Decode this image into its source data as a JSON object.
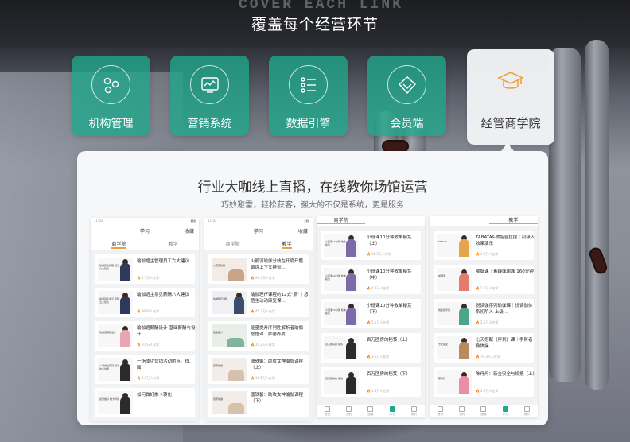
{
  "background_sign": "COVER EACH LINK",
  "heading": "覆盖每个经营环节",
  "tiles": [
    {
      "label": "机构管理",
      "icon": "nodes-icon"
    },
    {
      "label": "营销系统",
      "icon": "monitor-chart-icon"
    },
    {
      "label": "数据引擎",
      "icon": "list-icon"
    },
    {
      "label": "会员端",
      "icon": "diamond-icon"
    },
    {
      "label": "经管商学院",
      "icon": "graduation-cap-icon",
      "active": true
    }
  ],
  "colors": {
    "tile_green": "#1fa88c",
    "accent_orange": "#f0a13a",
    "card_bg": "#f6f7f9"
  },
  "card": {
    "title": "行业大咖线上直播，在线教你场馆运营",
    "subtitle": "巧妙避雷，轻松获客，强大的不仅是系统，更是服务"
  },
  "phones": [
    {
      "status_time": "11:02",
      "header_title": "学习",
      "header_right": "收藏",
      "tabs": [
        {
          "label": "商学院",
          "on": true
        },
        {
          "label": "教学",
          "on": false
        }
      ],
      "items": [
        {
          "thumb": "瑜伽馆主管理 员工六大建议",
          "title": "瑜伽馆主管理员工六大建议",
          "views": "1.1万人在学"
        },
        {
          "thumb": "瑜伽馆主常见 薪酬五大建议",
          "title": "瑜伽馆主常见薪酬八大建议",
          "views": "9695人在学"
        },
        {
          "thumb": "瑜伽馆薪酬设计",
          "title": "瑜伽馆薪酬设计-基础薪酬与设计",
          "views": "9.6万人在学"
        },
        {
          "thumb": "一场成功营销 活动的点线面",
          "title": "一场成功营销活动的点、线、面",
          "views": "1.1万人在学"
        },
        {
          "thumb": "如何做好 推卡转化",
          "title": "如何做好推卡转化",
          "views": ""
        }
      ]
    },
    {
      "status_time": "11:02",
      "header_title": "学习",
      "header_right": "收藏",
      "tabs": [
        {
          "label": "商学院",
          "on": false
        },
        {
          "label": "教学",
          "on": true
        }
      ],
      "items": [
        {
          "thumb": "火箭流瑜伽",
          "title": "火箭流瑜伽分歧在开肩开髋｜锻炼上下叉特训...",
          "views": "20.4万人在学"
        },
        {
          "thumb": "瑜伽理疗课程",
          "title": "瑜伽理疗课程的12式\"肌\"｜悠悟主动动康复保...",
          "views": "45.2万人在学"
        },
        {
          "thumb": "能量提升",
          "title": "能量提升序列胜解析者瑜伽｜悠悟课 · 萨德养成...",
          "views": "20.2万人在学"
        },
        {
          "thumb": "唐唐瑜伽",
          "title": "唐轶馨：助攻女神瑜伽课程（上）",
          "views": "11.5万人在学"
        },
        {
          "thumb": "唐唐瑜伽",
          "title": "唐轶馨：助攻女神瑜伽课程（下）",
          "views": ""
        }
      ]
    },
    {
      "header_title": "商学院",
      "items": [
        {
          "thumb": "小班课10分钟 收单秘笈",
          "title": "小班课10分钟收单秘笈（上）",
          "views": "16.2万人在学"
        },
        {
          "thumb": "小班课10分钟 收单秘笈",
          "title": "小班课10分钟收单秘笈（中）",
          "views": "4.4万人在学"
        },
        {
          "thumb": "小班课10分钟 收单秘笈",
          "title": "小班课10分钟收单秘笈（下）",
          "views": "5.1万人在学"
        },
        {
          "thumb": "百万团房的 秘笈",
          "title": "百万团房的秘笈（上）",
          "views": "3.5万人在学"
        },
        {
          "thumb": "百万团房的 秘笈",
          "title": "百万团房的秘笈（下）",
          "views": "1.8万人在学"
        }
      ],
      "nav": [
        "首页",
        "预约",
        "团课",
        "学习",
        "我的"
      ]
    },
    {
      "header_title": "教学",
      "items": [
        {
          "thumb": "TABATA",
          "title": "TABATA&燃脂普拉提｜初级入 效果演示",
          "views": "3.0万人在学"
        },
        {
          "thumb": "戒烟课",
          "title": "戒烟课｜素臻伽瑜伽 160分钟",
          "views": "1.0万人在学"
        },
        {
          "thumb": "悦读伽序列",
          "title": "悦读伽序列瑜伽课｜悦读伽体系初阶入 上级...",
          "views": "2.5万人在学"
        },
        {
          "thumb": "七天搭配",
          "title": "七天搭配（序列）课｜手臂者身体操",
          "views": "70.3万人在学"
        },
        {
          "thumb": "陈丹丹",
          "title": "陈丹丹：新金安全与规把（上）",
          "views": "4.8万人在学"
        }
      ],
      "nav": [
        "首页",
        "预约",
        "团课",
        "学习",
        "我的"
      ]
    }
  ]
}
